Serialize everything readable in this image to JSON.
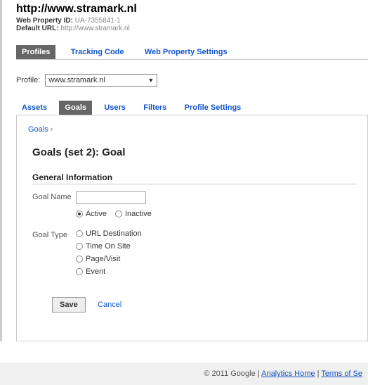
{
  "header": {
    "title": "http://www.stramark.nl",
    "prop_label": "Web Property ID:",
    "prop_value": "UA-7355841-1",
    "url_label": "Default URL:",
    "url_value": "http://www.stramark.nl"
  },
  "tabs": {
    "items": [
      "Profiles",
      "Tracking Code",
      "Web Property Settings"
    ],
    "active": 0
  },
  "profile": {
    "label": "Profile:",
    "value": "www.stramark.nl"
  },
  "subtabs": {
    "items": [
      "Assets",
      "Goals",
      "Users",
      "Filters",
      "Profile Settings"
    ],
    "active": 1
  },
  "breadcrumb": {
    "link": "Goals",
    "sep": "›"
  },
  "goal": {
    "title": "Goals (set 2): Goal",
    "section": "General Information",
    "name_label": "Goal Name",
    "name_value": "",
    "active_options": [
      "Active",
      "Inactive"
    ],
    "type_label": "Goal Type",
    "type_options": [
      "URL Destination",
      "Time On Site",
      "Page/Visit",
      "Event"
    ]
  },
  "buttons": {
    "save": "Save",
    "cancel": "Cancel"
  },
  "footer": {
    "copy": "© 2011 Google",
    "link1": "Analytics Home",
    "link2": "Terms of Se"
  }
}
